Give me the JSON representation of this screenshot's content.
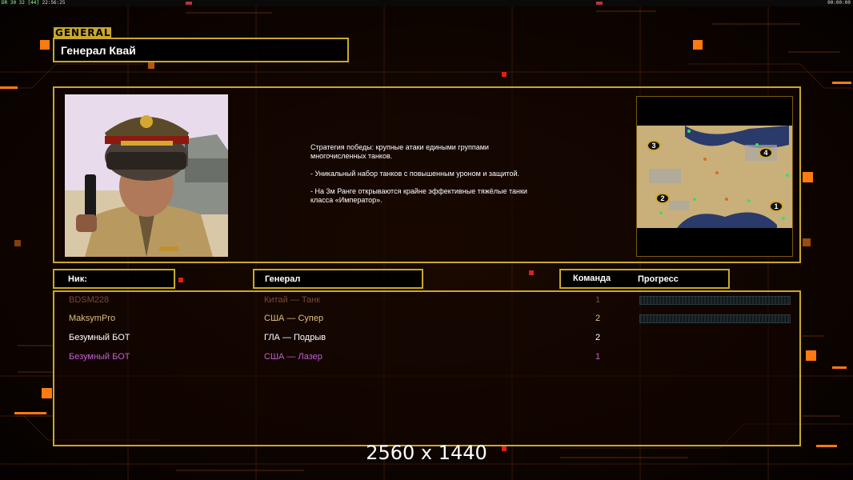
{
  "topbar": {
    "fps_text": "DR 30 32",
    "frame_text": "[44]",
    "clock_left": "22:56:25",
    "clock_right": "00:00:00"
  },
  "general": {
    "tag": "GENERAL",
    "name": "Генерал Квай",
    "description": [
      "Стратегия победы: крупные атаки едиными группами\n многочисленных танков.",
      "- Уникальный набор танков с повышенным уроном и защитой.",
      "- На 3м Ранге открываются крайне эффективные тяжёлые танки\n класса «Император»."
    ]
  },
  "minimap": {
    "start_positions": [
      "1",
      "2",
      "3",
      "4"
    ]
  },
  "columns": {
    "nick": "Ник:",
    "general": "Генерал",
    "team": "Команда",
    "progress": "Прогресс"
  },
  "players": [
    {
      "nick": "BDSM228",
      "general": "Китай — Танк",
      "team": "1",
      "color": "#7a4a3a",
      "progress": true
    },
    {
      "nick": "MaksymPro",
      "general": "США — Супер",
      "team": "2",
      "color": "#e0c080",
      "progress": true
    },
    {
      "nick": "Безумный БОТ",
      "general": "ГЛА — Подрыв",
      "team": "2",
      "color": "#ffffff",
      "progress": false
    },
    {
      "nick": "Безумный БОТ",
      "general": "США — Лазер",
      "team": "1",
      "color": "#c060d0",
      "progress": false
    }
  ],
  "resolution_label": "2560 x 1440",
  "colors": {
    "frame": "#c9a82a",
    "accent_orange": "#ff7a10",
    "accent_red": "#e02010"
  }
}
